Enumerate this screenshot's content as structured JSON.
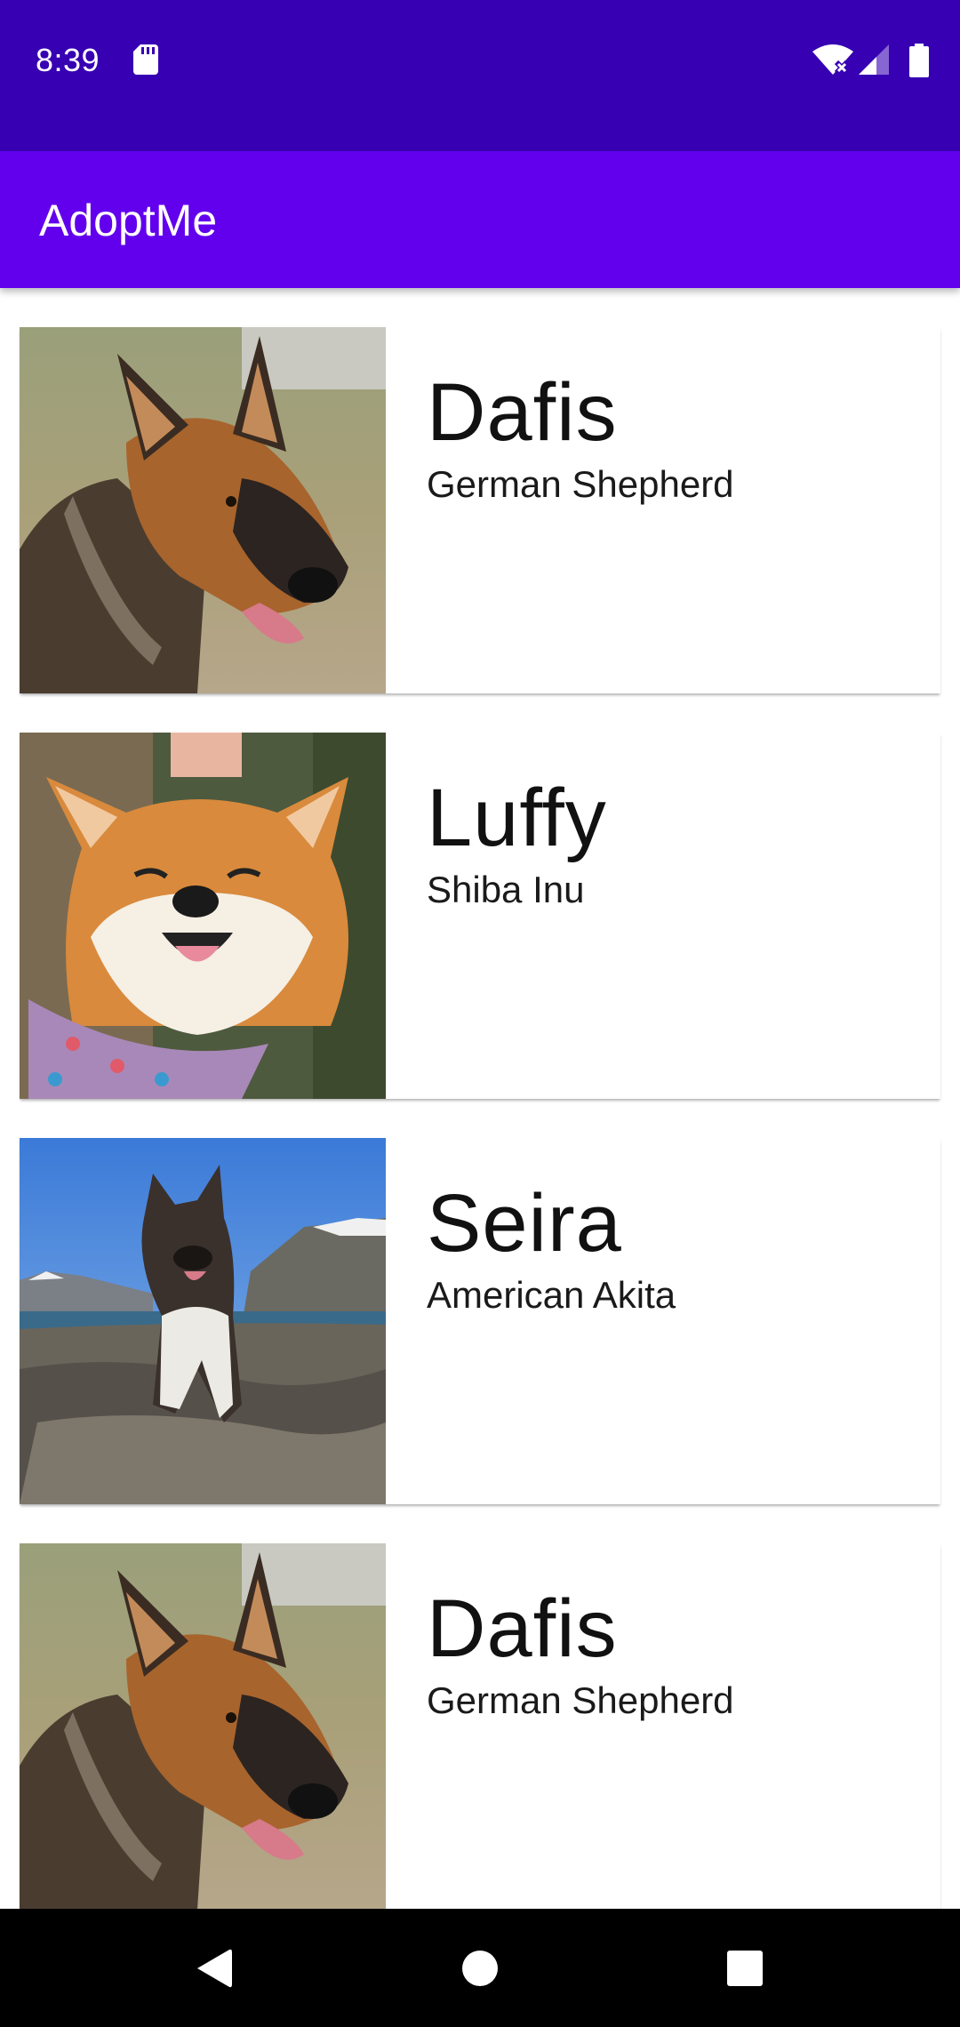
{
  "status_bar": {
    "time": "8:39",
    "icons": [
      "sd-card-icon",
      "wifi-off-icon",
      "cell-signal-icon",
      "battery-icon"
    ],
    "color": "#3700B3"
  },
  "app_bar": {
    "title": "AdoptMe",
    "color": "#6200EE"
  },
  "pets": [
    {
      "name": "Dafis",
      "breed": "German Shepherd",
      "photo": "german-shepherd-photo"
    },
    {
      "name": "Luffy",
      "breed": "Shiba Inu",
      "photo": "shiba-inu-photo"
    },
    {
      "name": "Seira",
      "breed": "American Akita",
      "photo": "american-akita-photo"
    },
    {
      "name": "Dafis",
      "breed": "German Shepherd",
      "photo": "german-shepherd-photo"
    }
  ],
  "nav_bar": {
    "icons": [
      "back-icon",
      "home-icon",
      "recents-icon"
    ]
  }
}
